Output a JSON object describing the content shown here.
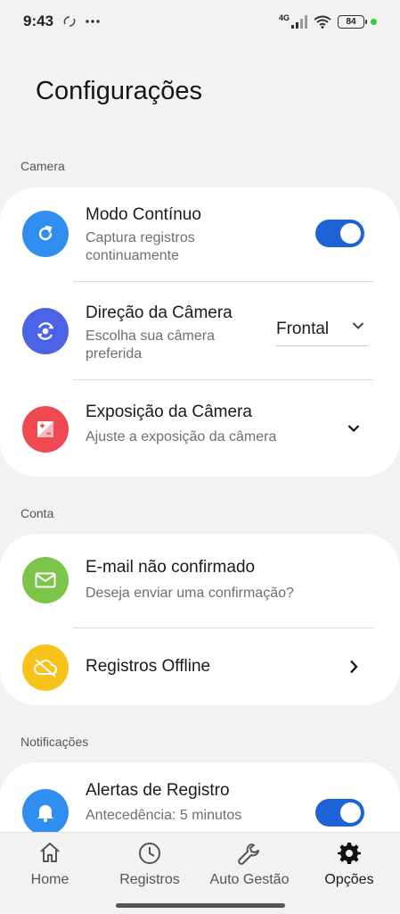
{
  "status_bar": {
    "time": "9:43",
    "network": "4G",
    "battery": "84"
  },
  "page": {
    "title": "Configurações"
  },
  "sections": {
    "camera": {
      "label": "Camera",
      "continuous_mode": {
        "title": "Modo Contínuo",
        "subtitle": "Captura registros continuamente",
        "enabled": true,
        "icon": "refresh-icon",
        "color": "#2f8ef0"
      },
      "camera_direction": {
        "title": "Direção da Câmera",
        "subtitle": "Escolha sua câmera preferida",
        "value": "Frontal",
        "icon": "camera-switch-icon",
        "color": "#4b63e6"
      },
      "camera_exposure": {
        "title": "Exposição da Câmera",
        "subtitle": "Ajuste a exposição da câmera",
        "icon": "exposure-icon",
        "color": "#ef4a52"
      }
    },
    "account": {
      "label": "Conta",
      "email": {
        "title": "E-mail não confirmado",
        "subtitle": "Deseja enviar uma confirmação?",
        "icon": "mail-icon",
        "color": "#7cc44a"
      },
      "offline": {
        "title": "Registros Offline",
        "icon": "cloud-off-icon",
        "color": "#f7c21a"
      }
    },
    "notifications": {
      "label": "Notificações",
      "alerts": {
        "title": "Alertas de Registro",
        "subtitle": "Antecedência: 5 minutos",
        "enabled": true,
        "icon": "bell-icon",
        "color": "#2f8ef0"
      }
    }
  },
  "bottom_nav": {
    "items": [
      {
        "label": "Home",
        "icon": "home-icon",
        "active": false
      },
      {
        "label": "Registros",
        "icon": "clock-icon",
        "active": false
      },
      {
        "label": "Auto Gestão",
        "icon": "wrench-icon",
        "active": false
      },
      {
        "label": "Opções",
        "icon": "gear-icon",
        "active": true
      }
    ]
  }
}
